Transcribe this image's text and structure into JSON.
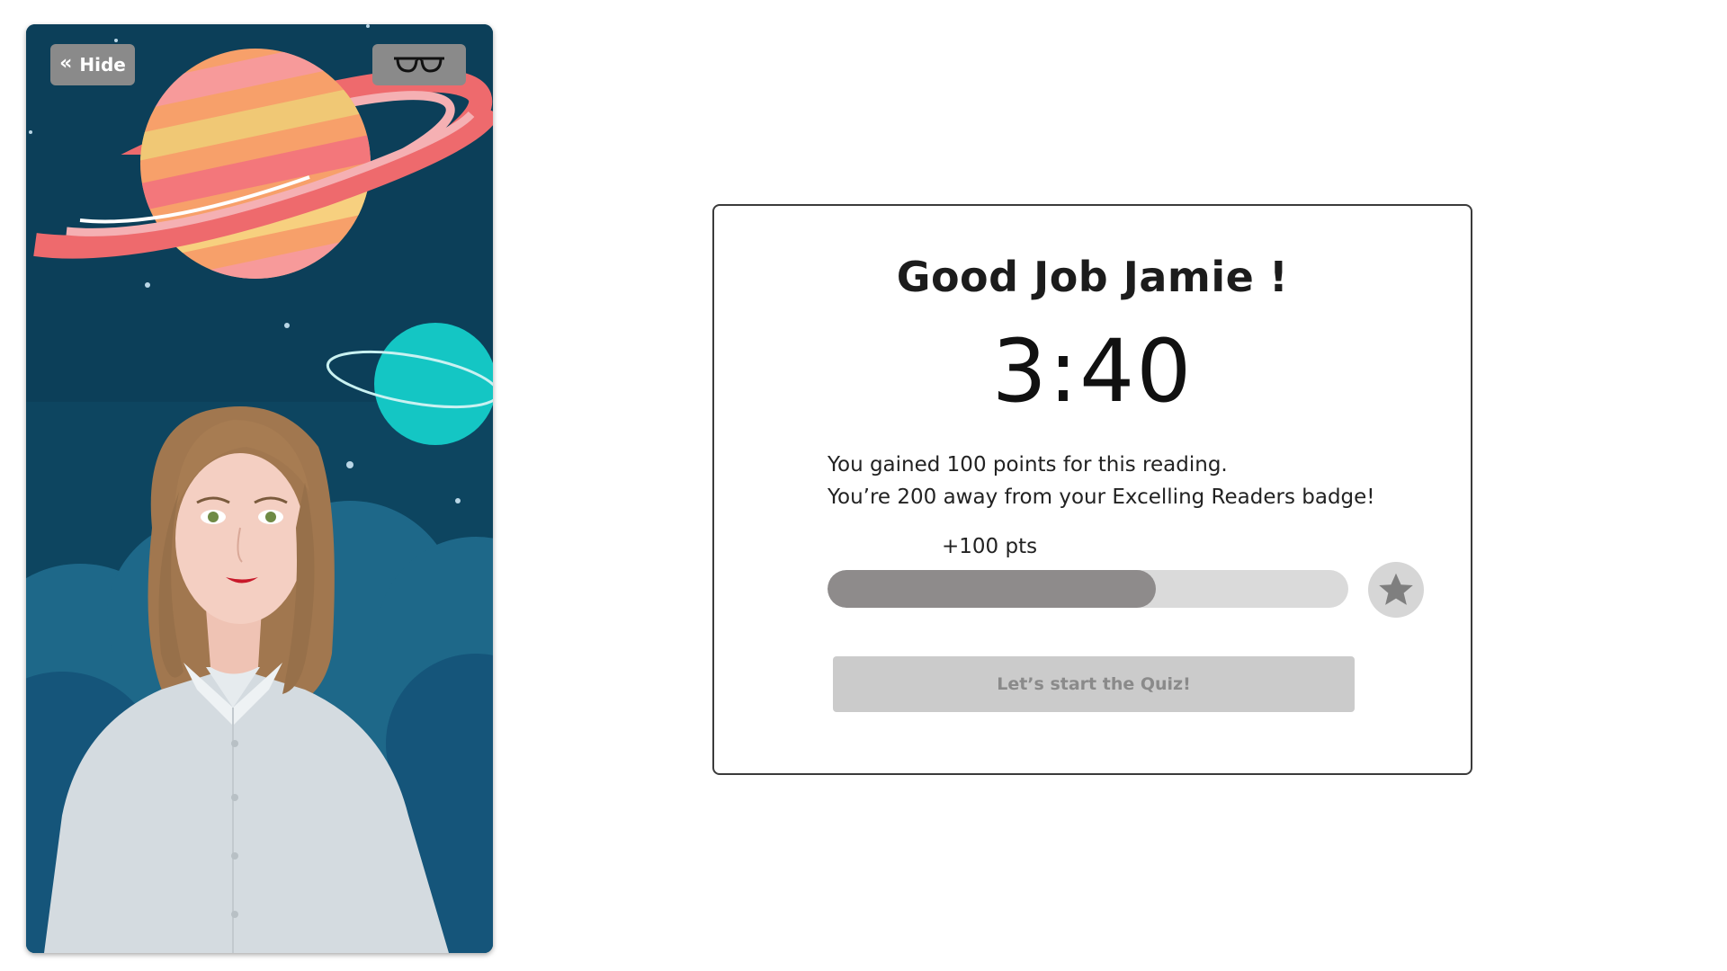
{
  "avatar_panel": {
    "hide_label": "Hide",
    "hide_icon": "double-chevron-left-icon",
    "glasses_icon": "glasses-icon"
  },
  "result": {
    "greeting": "Good Job Jamie !",
    "timer": "3:40",
    "message_line_1": "You gained 100 points for this reading.",
    "message_line_2": "You’re 200 away from your Excelling Readers badge!",
    "points_label": "+100 pts",
    "progress_fraction": 0.63,
    "badge_icon": "star-icon",
    "quiz_button_label": "Let’s start the Quiz!"
  },
  "colors": {
    "scene_background": "#0d4560",
    "progress_fill": "#8e8b8b",
    "progress_track": "#dadada",
    "button_disabled": "#cbcbcb"
  }
}
